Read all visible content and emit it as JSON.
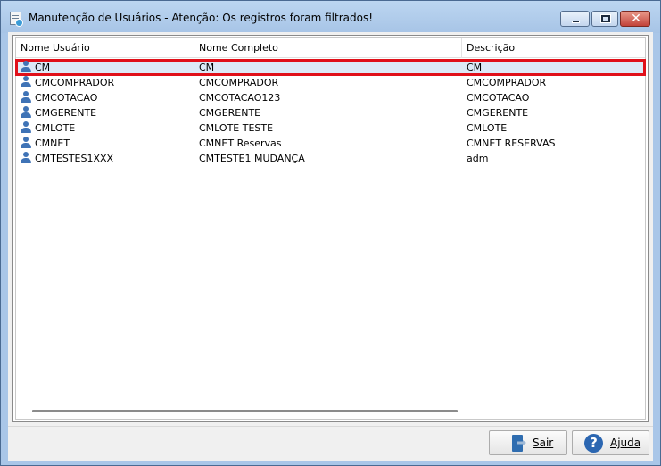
{
  "window": {
    "title": "Manutenção de Usuários - Atenção: Os registros foram filtrados!"
  },
  "controls": {
    "close_glyph": "✕"
  },
  "grid": {
    "columns": [
      "Nome Usuário",
      "Nome Completo",
      "Descrição"
    ],
    "selected_index": 0,
    "rows": [
      {
        "icon": "user-icon",
        "usuario": "CM",
        "completo": "CM",
        "descricao": "CM"
      },
      {
        "icon": "user-icon",
        "usuario": "CMCOMPRADOR",
        "completo": "CMCOMPRADOR",
        "descricao": "CMCOMPRADOR"
      },
      {
        "icon": "user-icon",
        "usuario": "CMCOTACAO",
        "completo": "CMCOTACAO123",
        "descricao": "CMCOTACAO"
      },
      {
        "icon": "user-icon",
        "usuario": "CMGERENTE",
        "completo": "CMGERENTE",
        "descricao": "CMGERENTE"
      },
      {
        "icon": "user-icon",
        "usuario": "CMLOTE",
        "completo": "CMLOTE TESTE",
        "descricao": "CMLOTE"
      },
      {
        "icon": "user-icon",
        "usuario": "CMNET",
        "completo": "CMNET Reservas",
        "descricao": "CMNET RESERVAS"
      },
      {
        "icon": "user-icon",
        "usuario": "CMTESTES1XXX",
        "completo": "CMTESTE1 MUDANÇA",
        "descricao": "adm"
      }
    ]
  },
  "buttons": {
    "sair": "Sair",
    "ajuda": "Ajuda",
    "help_glyph": "?"
  },
  "colors": {
    "selection_outline": "#e0101a",
    "selection_fill": "#dce9f7",
    "icon_blue": "#3f73b6",
    "titlebar": "#a9c6e8"
  }
}
